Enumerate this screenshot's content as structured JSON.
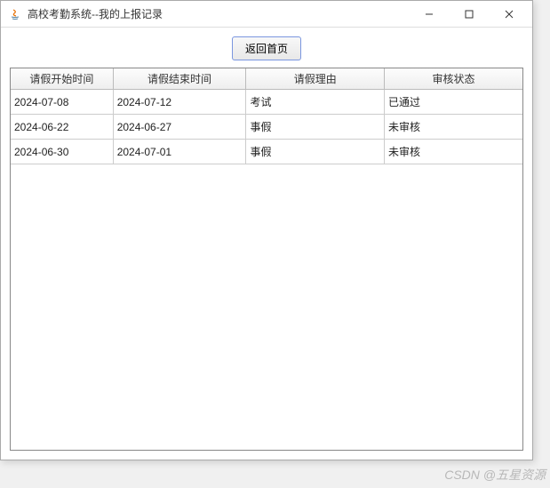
{
  "window": {
    "title": "高校考勤系统--我的上报记录"
  },
  "toolbar": {
    "return_label": "返回首页"
  },
  "table": {
    "headers": {
      "start_time": "请假开始时间",
      "end_time": "请假结束时间",
      "reason": "请假理由",
      "status": "审核状态"
    },
    "rows": [
      {
        "start": "2024-07-08",
        "end": "2024-07-12",
        "reason": "考试",
        "status": "已通过"
      },
      {
        "start": "2024-06-22",
        "end": "2024-06-27",
        "reason": "事假",
        "status": "未审核"
      },
      {
        "start": "2024-06-30",
        "end": "2024-07-01",
        "reason": "事假",
        "status": "未审核"
      }
    ]
  },
  "watermark": "CSDN @五星资源"
}
